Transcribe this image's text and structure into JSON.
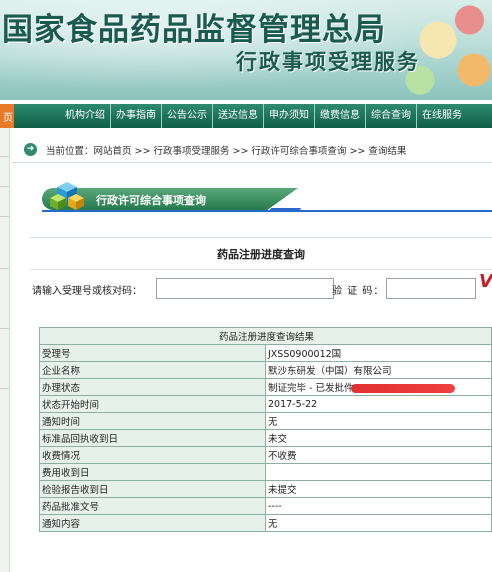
{
  "header": {
    "title": "国家食品药品监督管理总局",
    "subtitle": "行政事项受理服务"
  },
  "nav": {
    "home_fragment": "页",
    "items": [
      "机构介绍",
      "办事指南",
      "公告公示",
      "送达信息",
      "申办须知",
      "缴费信息",
      "综合查询",
      "在线服务"
    ]
  },
  "breadcrumb": {
    "text": "当前位置：网站首页 >> 行政事项受理服务 >> 行政许可综合事项查询 >> 查询结果"
  },
  "section": {
    "title": "行政许可综合事项查询"
  },
  "query": {
    "title": "药品注册进度查询",
    "accept_no_label": "请输入受理号或核对码：",
    "accept_no_value": "",
    "captcha_label": "验 证 码：",
    "captcha_value": "",
    "captcha_image_text": "V"
  },
  "results": {
    "title": "药品注册进度查询结果",
    "rows": [
      {
        "key": "受理号",
        "value": "JXSS0900012国"
      },
      {
        "key": "企业名称",
        "value": "默沙东研发（中国）有限公司"
      },
      {
        "key": "办理状态",
        "value": "制证完毕 - 已发批件"
      },
      {
        "key": "状态开始时间",
        "value": "2017-5-22"
      },
      {
        "key": "通知时间",
        "value": "无"
      },
      {
        "key": "标准品回执收到日",
        "value": "未交"
      },
      {
        "key": "收费情况",
        "value": "不收费"
      },
      {
        "key": "费用收到日",
        "value": ""
      },
      {
        "key": "检验报告收到日",
        "value": "未提交"
      },
      {
        "key": "药品批准文号",
        "value": "----"
      },
      {
        "key": "通知内容",
        "value": "无"
      }
    ]
  },
  "colors": {
    "nav_green": "#0e5f47",
    "accent_orange": "#e77b2a",
    "accent_blue": "#2a6acb",
    "redaction_red": "#e23030"
  }
}
